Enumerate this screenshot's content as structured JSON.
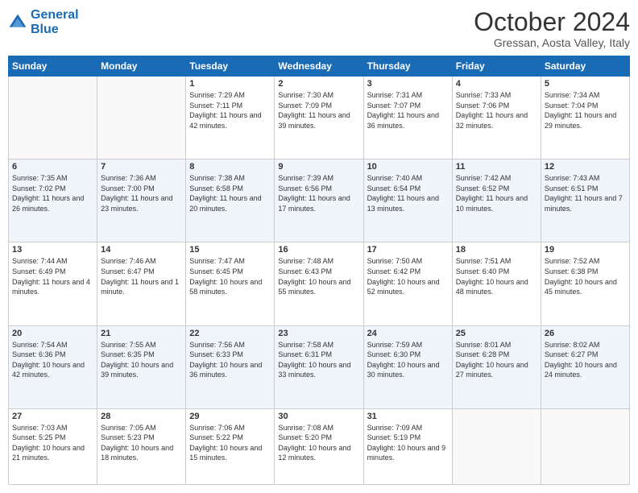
{
  "header": {
    "logo_line1": "General",
    "logo_line2": "Blue",
    "month": "October 2024",
    "location": "Gressan, Aosta Valley, Italy"
  },
  "weekdays": [
    "Sunday",
    "Monday",
    "Tuesday",
    "Wednesday",
    "Thursday",
    "Friday",
    "Saturday"
  ],
  "weeks": [
    [
      {
        "day": "",
        "text": ""
      },
      {
        "day": "",
        "text": ""
      },
      {
        "day": "1",
        "text": "Sunrise: 7:29 AM\nSunset: 7:11 PM\nDaylight: 11 hours and 42 minutes."
      },
      {
        "day": "2",
        "text": "Sunrise: 7:30 AM\nSunset: 7:09 PM\nDaylight: 11 hours and 39 minutes."
      },
      {
        "day": "3",
        "text": "Sunrise: 7:31 AM\nSunset: 7:07 PM\nDaylight: 11 hours and 36 minutes."
      },
      {
        "day": "4",
        "text": "Sunrise: 7:33 AM\nSunset: 7:06 PM\nDaylight: 11 hours and 32 minutes."
      },
      {
        "day": "5",
        "text": "Sunrise: 7:34 AM\nSunset: 7:04 PM\nDaylight: 11 hours and 29 minutes."
      }
    ],
    [
      {
        "day": "6",
        "text": "Sunrise: 7:35 AM\nSunset: 7:02 PM\nDaylight: 11 hours and 26 minutes."
      },
      {
        "day": "7",
        "text": "Sunrise: 7:36 AM\nSunset: 7:00 PM\nDaylight: 11 hours and 23 minutes."
      },
      {
        "day": "8",
        "text": "Sunrise: 7:38 AM\nSunset: 6:58 PM\nDaylight: 11 hours and 20 minutes."
      },
      {
        "day": "9",
        "text": "Sunrise: 7:39 AM\nSunset: 6:56 PM\nDaylight: 11 hours and 17 minutes."
      },
      {
        "day": "10",
        "text": "Sunrise: 7:40 AM\nSunset: 6:54 PM\nDaylight: 11 hours and 13 minutes."
      },
      {
        "day": "11",
        "text": "Sunrise: 7:42 AM\nSunset: 6:52 PM\nDaylight: 11 hours and 10 minutes."
      },
      {
        "day": "12",
        "text": "Sunrise: 7:43 AM\nSunset: 6:51 PM\nDaylight: 11 hours and 7 minutes."
      }
    ],
    [
      {
        "day": "13",
        "text": "Sunrise: 7:44 AM\nSunset: 6:49 PM\nDaylight: 11 hours and 4 minutes."
      },
      {
        "day": "14",
        "text": "Sunrise: 7:46 AM\nSunset: 6:47 PM\nDaylight: 11 hours and 1 minute."
      },
      {
        "day": "15",
        "text": "Sunrise: 7:47 AM\nSunset: 6:45 PM\nDaylight: 10 hours and 58 minutes."
      },
      {
        "day": "16",
        "text": "Sunrise: 7:48 AM\nSunset: 6:43 PM\nDaylight: 10 hours and 55 minutes."
      },
      {
        "day": "17",
        "text": "Sunrise: 7:50 AM\nSunset: 6:42 PM\nDaylight: 10 hours and 52 minutes."
      },
      {
        "day": "18",
        "text": "Sunrise: 7:51 AM\nSunset: 6:40 PM\nDaylight: 10 hours and 48 minutes."
      },
      {
        "day": "19",
        "text": "Sunrise: 7:52 AM\nSunset: 6:38 PM\nDaylight: 10 hours and 45 minutes."
      }
    ],
    [
      {
        "day": "20",
        "text": "Sunrise: 7:54 AM\nSunset: 6:36 PM\nDaylight: 10 hours and 42 minutes."
      },
      {
        "day": "21",
        "text": "Sunrise: 7:55 AM\nSunset: 6:35 PM\nDaylight: 10 hours and 39 minutes."
      },
      {
        "day": "22",
        "text": "Sunrise: 7:56 AM\nSunset: 6:33 PM\nDaylight: 10 hours and 36 minutes."
      },
      {
        "day": "23",
        "text": "Sunrise: 7:58 AM\nSunset: 6:31 PM\nDaylight: 10 hours and 33 minutes."
      },
      {
        "day": "24",
        "text": "Sunrise: 7:59 AM\nSunset: 6:30 PM\nDaylight: 10 hours and 30 minutes."
      },
      {
        "day": "25",
        "text": "Sunrise: 8:01 AM\nSunset: 6:28 PM\nDaylight: 10 hours and 27 minutes."
      },
      {
        "day": "26",
        "text": "Sunrise: 8:02 AM\nSunset: 6:27 PM\nDaylight: 10 hours and 24 minutes."
      }
    ],
    [
      {
        "day": "27",
        "text": "Sunrise: 7:03 AM\nSunset: 5:25 PM\nDaylight: 10 hours and 21 minutes."
      },
      {
        "day": "28",
        "text": "Sunrise: 7:05 AM\nSunset: 5:23 PM\nDaylight: 10 hours and 18 minutes."
      },
      {
        "day": "29",
        "text": "Sunrise: 7:06 AM\nSunset: 5:22 PM\nDaylight: 10 hours and 15 minutes."
      },
      {
        "day": "30",
        "text": "Sunrise: 7:08 AM\nSunset: 5:20 PM\nDaylight: 10 hours and 12 minutes."
      },
      {
        "day": "31",
        "text": "Sunrise: 7:09 AM\nSunset: 5:19 PM\nDaylight: 10 hours and 9 minutes."
      },
      {
        "day": "",
        "text": ""
      },
      {
        "day": "",
        "text": ""
      }
    ]
  ]
}
